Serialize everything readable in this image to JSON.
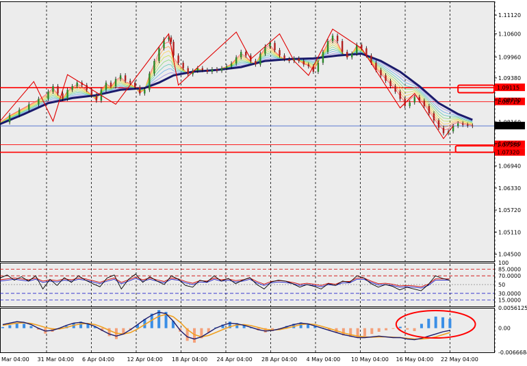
{
  "colors": {
    "background": "#ececec",
    "frame": "#000000",
    "grid": "#000000",
    "ma_thick": "#1a1a6b",
    "zigzag": "#e00000",
    "level_line": "#ff0000",
    "current_price_line": "#4466cc",
    "callout": "#ff0000",
    "hist_positive": "#3a8ee6",
    "hist_negative": "#f4a07a",
    "signal_line": "#f0a020",
    "macd_line": "#1a1a6b",
    "osc_main": "#000000",
    "osc_signal_red": "#d00000",
    "osc_signal_blue": "#2222cc"
  },
  "chart_data": [
    {
      "type": "line",
      "panel": "price",
      "ylim": [
        1.043,
        1.115
      ],
      "y_ticks": [
        "1.11120",
        "1.10600",
        "1.09960",
        "1.09380",
        "1.08770",
        "1.08160",
        "1.07560",
        "1.06940",
        "1.06330",
        "1.05720",
        "1.05110",
        "1.04500"
      ],
      "x_date_labels": [
        "Mar 04:00",
        "31 Mar 04:00",
        "6 Apr 04:00",
        "12 Apr 04:00",
        "18 Apr 04:00",
        "24 Apr 04:00",
        "28 Apr 04:00",
        "4 May 04:00",
        "10 May 04:00",
        "16 May 04:00",
        "22 May 04:00"
      ],
      "price_points": [
        [
          0,
          1.0815
        ],
        [
          4,
          1.0835
        ],
        [
          8,
          1.085
        ],
        [
          12,
          1.0865
        ],
        [
          16,
          1.088
        ],
        [
          20,
          1.09
        ],
        [
          22,
          1.0915
        ],
        [
          24,
          1.0895
        ],
        [
          26,
          1.088
        ],
        [
          28,
          1.0905
        ],
        [
          30,
          1.0915
        ],
        [
          32,
          1.0925
        ],
        [
          34,
          1.0918
        ],
        [
          36,
          1.0905
        ],
        [
          38,
          1.089
        ],
        [
          40,
          1.0875
        ],
        [
          42,
          1.0905
        ],
        [
          44,
          1.0925
        ],
        [
          46,
          1.0915
        ],
        [
          48,
          1.0935
        ],
        [
          50,
          1.0945
        ],
        [
          52,
          1.093
        ],
        [
          54,
          1.0925
        ],
        [
          56,
          1.0912
        ],
        [
          58,
          1.0895
        ],
        [
          60,
          1.0905
        ],
        [
          62,
          1.095
        ],
        [
          64,
          1.0985
        ],
        [
          66,
          1.102
        ],
        [
          68,
          1.1045
        ],
        [
          70,
          1.105
        ],
        [
          71,
          1.1038
        ],
        [
          72,
          1.1
        ],
        [
          74,
          1.098
        ],
        [
          76,
          1.0965
        ],
        [
          78,
          1.0948
        ],
        [
          80,
          1.0958
        ],
        [
          82,
          1.0965
        ],
        [
          84,
          1.096
        ],
        [
          86,
          1.0955
        ],
        [
          88,
          1.0962
        ],
        [
          90,
          1.0958
        ],
        [
          92,
          1.0965
        ],
        [
          94,
          1.097
        ],
        [
          96,
          1.0978
        ],
        [
          98,
          1.0995
        ],
        [
          100,
          1.101
        ],
        [
          102,
          1.1
        ],
        [
          104,
          1.0985
        ],
        [
          106,
          1.0975
        ],
        [
          108,
          1.1005
        ],
        [
          110,
          1.1025
        ],
        [
          112,
          1.1035
        ],
        [
          114,
          1.1015
        ],
        [
          116,
          1.1
        ],
        [
          118,
          1.099
        ],
        [
          120,
          1.0985
        ],
        [
          122,
          1.0992
        ],
        [
          124,
          1.0985
        ],
        [
          126,
          1.0975
        ],
        [
          128,
          1.097
        ],
        [
          130,
          1.0955
        ],
        [
          132,
          1.098
        ],
        [
          134,
          1.101
        ],
        [
          136,
          1.104
        ],
        [
          138,
          1.1055
        ],
        [
          140,
          1.104
        ],
        [
          142,
          1.101
        ],
        [
          144,
          1.0995
        ],
        [
          146,
          1.1005
        ],
        [
          148,
          1.103
        ],
        [
          150,
          1.102
        ],
        [
          152,
          1.1
        ],
        [
          154,
          1.098
        ],
        [
          156,
          1.096
        ],
        [
          158,
          1.0945
        ],
        [
          160,
          1.093
        ],
        [
          162,
          1.0915
        ],
        [
          164,
          1.09
        ],
        [
          166,
          1.088
        ],
        [
          168,
          1.086
        ],
        [
          170,
          1.087
        ],
        [
          172,
          1.0885
        ],
        [
          174,
          1.0875
        ],
        [
          176,
          1.086
        ],
        [
          178,
          1.084
        ],
        [
          180,
          1.082
        ],
        [
          182,
          1.08
        ],
        [
          184,
          1.0785
        ],
        [
          186,
          1.079
        ],
        [
          188,
          1.0805
        ],
        [
          190,
          1.0812
        ],
        [
          192,
          1.0808
        ],
        [
          194,
          1.0806
        ],
        [
          196,
          1.0805
        ]
      ],
      "ma_points": [
        [
          0,
          1.081
        ],
        [
          10,
          1.0838
        ],
        [
          20,
          1.0868
        ],
        [
          30,
          1.0882
        ],
        [
          40,
          1.089
        ],
        [
          50,
          1.0905
        ],
        [
          60,
          1.091
        ],
        [
          66,
          1.0925
        ],
        [
          72,
          1.0945
        ],
        [
          80,
          1.0955
        ],
        [
          90,
          1.096
        ],
        [
          100,
          1.0968
        ],
        [
          110,
          1.0985
        ],
        [
          120,
          1.099
        ],
        [
          130,
          1.0992
        ],
        [
          140,
          1.1
        ],
        [
          150,
          1.1005
        ],
        [
          158,
          1.0985
        ],
        [
          166,
          1.0955
        ],
        [
          174,
          1.0915
        ],
        [
          182,
          1.0868
        ],
        [
          190,
          1.0838
        ],
        [
          196,
          1.0822
        ]
      ],
      "zigzag_points": [
        [
          0,
          1.0818
        ],
        [
          14,
          1.0928
        ],
        [
          22,
          1.0818
        ],
        [
          28,
          1.0947
        ],
        [
          48,
          1.0865
        ],
        [
          70,
          1.106
        ],
        [
          74,
          1.0918
        ],
        [
          98,
          1.1065
        ],
        [
          104,
          1.099
        ],
        [
          116,
          1.106
        ],
        [
          122,
          1.0985
        ],
        [
          128,
          1.0945
        ],
        [
          138,
          1.1073
        ],
        [
          150,
          1.102
        ],
        [
          166,
          1.0855
        ],
        [
          172,
          1.0895
        ],
        [
          184,
          1.077
        ],
        [
          188,
          1.0805
        ]
      ],
      "levels": [
        {
          "value": 1.0911,
          "label": "1.09115",
          "bold": true
        },
        {
          "value": 1.0872,
          "label": "1.08719",
          "bold": false
        },
        {
          "value": 1.0805,
          "label": "1.08054",
          "current": true
        },
        {
          "value": 1.0753,
          "label": "1.07530",
          "bold": false
        },
        {
          "value": 1.0732,
          "label": "1.07320",
          "bold": true
        }
      ],
      "callouts": [
        {
          "x_from": 190,
          "x_to": 205,
          "y_from": 1.0918,
          "y_to": 1.0897
        },
        {
          "x_from": 189,
          "x_to": 205,
          "y_from": 1.075,
          "y_to": 1.0732
        }
      ]
    },
    {
      "type": "line",
      "panel": "oscillator",
      "ylim": [
        0,
        100
      ],
      "y_ticks": [
        "100",
        "85.0000",
        "70.0000",
        "50",
        "30.0000",
        "15.0000"
      ],
      "level_values": [
        85,
        70,
        50,
        30,
        15
      ],
      "main_series": [
        65,
        72,
        60,
        68,
        58,
        70,
        40,
        62,
        48,
        66,
        55,
        70,
        60,
        52,
        45,
        65,
        72,
        40,
        62,
        74,
        55,
        68,
        58,
        50,
        70,
        62,
        48,
        44,
        60,
        56,
        70,
        58,
        64,
        52,
        60,
        66,
        50,
        40,
        56,
        60,
        58,
        52,
        44,
        50,
        46,
        40,
        52,
        48,
        58,
        55,
        70,
        65,
        52,
        44,
        50,
        46,
        38,
        44,
        40,
        36,
        50,
        70,
        64,
        60
      ],
      "signal_series": [
        58,
        60,
        62,
        60,
        58,
        62,
        55,
        58,
        56,
        60,
        58,
        62,
        60,
        56,
        52,
        58,
        62,
        52,
        58,
        64,
        58,
        62,
        58,
        54,
        62,
        60,
        54,
        50,
        56,
        55,
        62,
        58,
        60,
        56,
        58,
        62,
        54,
        48,
        54,
        56,
        55,
        52,
        48,
        50,
        48,
        45,
        50,
        48,
        54,
        54,
        62,
        62,
        55,
        49,
        50,
        48,
        44,
        45,
        44,
        42,
        48,
        60,
        60,
        60
      ]
    },
    {
      "type": "bar",
      "panel": "macd",
      "ylim": [
        -0.0066684,
        0.0056125
      ],
      "y_ticks": [
        "0.0056125",
        "0.00",
        "-0.0066684"
      ],
      "histogram": [
        0.0003,
        0.0008,
        0.0015,
        0.0012,
        0.0006,
        -0.0004,
        -0.0015,
        -0.001,
        -0.0002,
        0.0006,
        0.0014,
        0.0018,
        0.0012,
        0.0004,
        -0.0008,
        -0.0022,
        -0.003,
        -0.0018,
        -0.0006,
        0.001,
        0.0025,
        0.004,
        0.005,
        0.0045,
        0.002,
        -0.001,
        -0.0035,
        -0.004,
        -0.0028,
        -0.0012,
        0.0002,
        0.001,
        0.0018,
        0.0014,
        0.0008,
        0.0002,
        -0.0006,
        -0.0012,
        -0.0008,
        -0.0003,
        0.0006,
        0.0012,
        0.0016,
        0.0012,
        0.0006,
        0.0001,
        -0.0006,
        -0.0012,
        -0.002,
        -0.0024,
        -0.0026,
        -0.0022,
        -0.0016,
        -0.001,
        -0.0006,
        -0.0002,
        0.0004,
        -0.0004,
        -0.0008,
        0.0012,
        0.0026,
        0.0032,
        0.003,
        0.0026
      ],
      "macd_line": [
        0.001,
        0.0014,
        0.0018,
        0.0016,
        0.001,
        0.0,
        -0.0008,
        -0.0006,
        0.0,
        0.0008,
        0.0014,
        0.0016,
        0.0012,
        0.0005,
        -0.0006,
        -0.0016,
        -0.0022,
        -0.0016,
        -0.0004,
        0.001,
        0.0024,
        0.0036,
        0.0044,
        0.004,
        0.002,
        -0.0006,
        -0.0024,
        -0.003,
        -0.0024,
        -0.0012,
        0.0,
        0.0008,
        0.0014,
        0.0012,
        0.0008,
        0.0002,
        -0.0004,
        -0.0008,
        -0.0006,
        -0.0002,
        0.0004,
        0.001,
        0.0014,
        0.0012,
        0.0006,
        0.0,
        -0.0006,
        -0.0012,
        -0.0018,
        -0.0022,
        -0.0026,
        -0.0026,
        -0.0024,
        -0.0022,
        -0.0024,
        -0.0026,
        -0.0026,
        -0.003,
        -0.0032,
        -0.0028,
        -0.0022,
        -0.0016,
        -0.001,
        -0.0006
      ],
      "signal_line": [
        0.0008,
        0.0011,
        0.0014,
        0.0015,
        0.0013,
        0.0008,
        0.0002,
        -0.0002,
        -0.0002,
        0.0002,
        0.0008,
        0.0012,
        0.0013,
        0.001,
        0.0003,
        -0.0006,
        -0.0014,
        -0.0016,
        -0.0012,
        -0.0002,
        0.001,
        0.0022,
        0.0033,
        0.0038,
        0.0032,
        0.0016,
        -0.0004,
        -0.0018,
        -0.0024,
        -0.002,
        -0.0012,
        -0.0004,
        0.0004,
        0.0009,
        0.001,
        0.0007,
        0.0002,
        -0.0003,
        -0.0005,
        -0.0004,
        0.0,
        0.0005,
        0.001,
        0.0012,
        0.001,
        0.0005,
        -0.0001,
        -0.0007,
        -0.0013,
        -0.0018,
        -0.0022,
        -0.0024,
        -0.0025,
        -0.0024,
        -0.0024,
        -0.0025,
        -0.0026,
        -0.0028,
        -0.003,
        -0.003,
        -0.0028,
        -0.0024,
        -0.0018,
        -0.0012
      ],
      "callout_ellipse": {
        "from_index": 56,
        "to_index": 66
      }
    }
  ]
}
